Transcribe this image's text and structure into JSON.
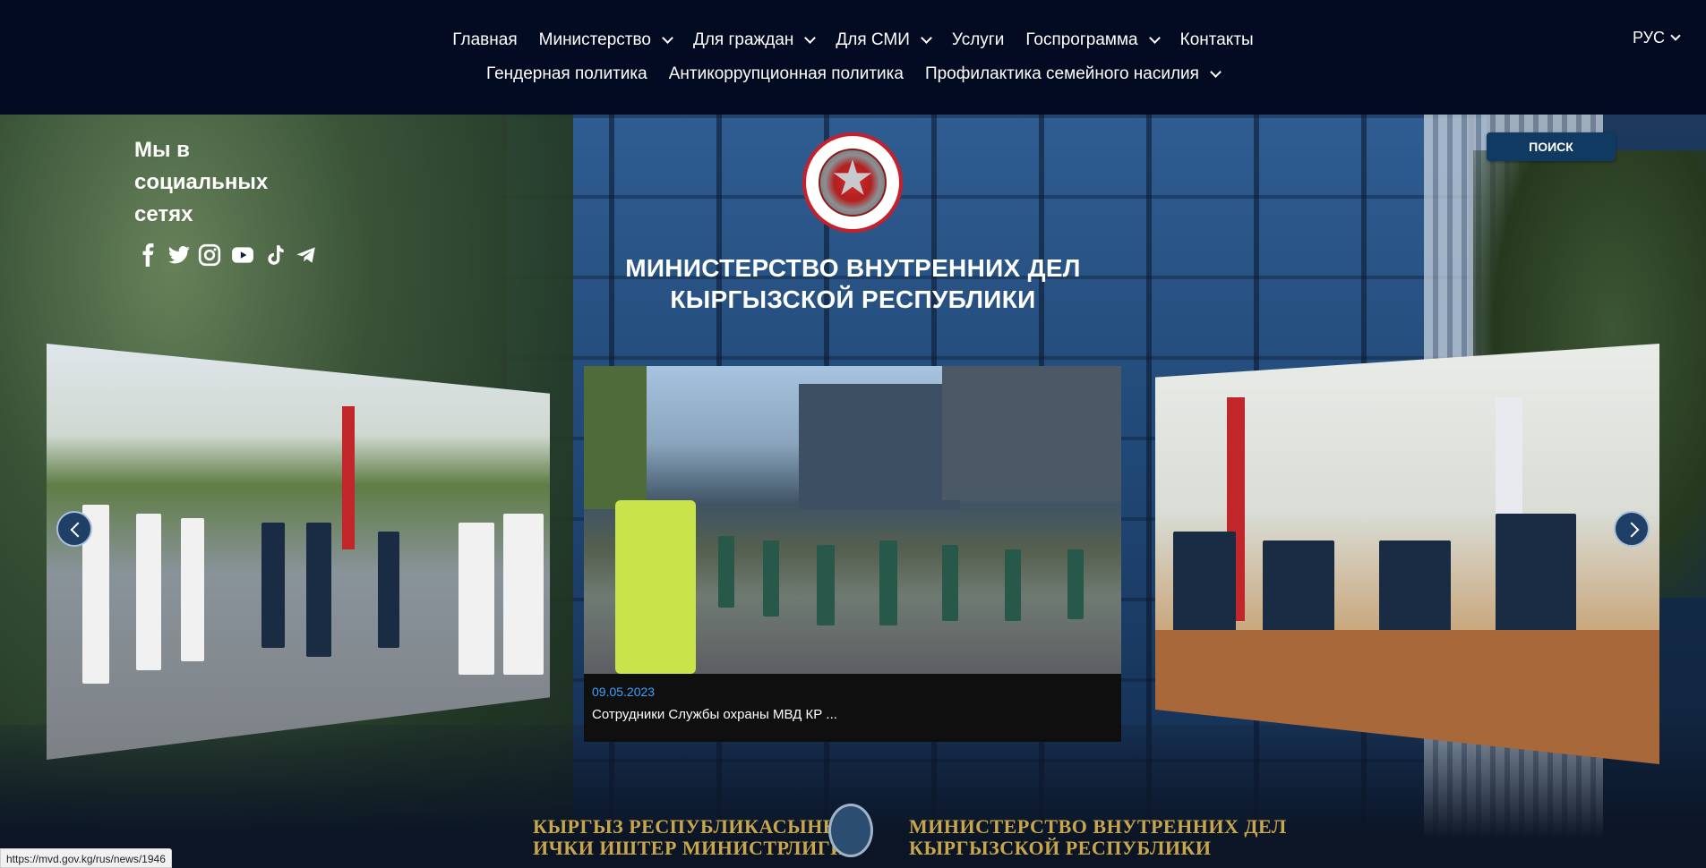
{
  "nav": {
    "row1": [
      {
        "label": "Главная",
        "dropdown": false
      },
      {
        "label": "Министерство",
        "dropdown": true
      },
      {
        "label": "Для граждан",
        "dropdown": true
      },
      {
        "label": "Для СМИ",
        "dropdown": true
      },
      {
        "label": "Услуги",
        "dropdown": false
      },
      {
        "label": "Госпрограмма",
        "dropdown": true
      },
      {
        "label": "Контакты",
        "dropdown": false
      }
    ],
    "row2": [
      {
        "label": "Гендерная политика",
        "dropdown": false
      },
      {
        "label": "Антикоррупционная политика",
        "dropdown": false
      },
      {
        "label": "Профилактика семейного насилия",
        "dropdown": true
      }
    ],
    "language": "РУС"
  },
  "social": {
    "title": "Мы в социальных сетях",
    "icons": [
      "facebook-icon",
      "twitter-icon",
      "instagram-icon",
      "youtube-icon",
      "tiktok-icon",
      "telegram-icon"
    ]
  },
  "header": {
    "title_line1": "МИНИСТЕРСТВО ВНУТРЕННИХ ДЕЛ",
    "title_line2": "КЫРГЫЗСКОЙ РЕСПУБЛИКИ",
    "search_label": "ПОИСК"
  },
  "carousel": {
    "active": {
      "date": "09.05.2023",
      "text": "Сотрудники Службы охраны МВД КР ..."
    }
  },
  "background_sign": {
    "left_line1": "КЫРГЫЗ РЕСПУБЛИКАСЫНЫН",
    "left_line2": "ИЧКИ ИШТЕР МИНИСТРЛИГИ",
    "right_line1": "МИНИСТЕРСТВО ВНУТРЕННИХ ДЕЛ",
    "right_line2": "КЫРГЫЗСКОЙ РЕСПУБЛИКИ"
  },
  "status_url": "https://mvd.gov.kg/rus/news/1946",
  "colors": {
    "nav_bg": "#020b22",
    "accent_date": "#3ea0ff",
    "search_bg": "#103a61"
  }
}
